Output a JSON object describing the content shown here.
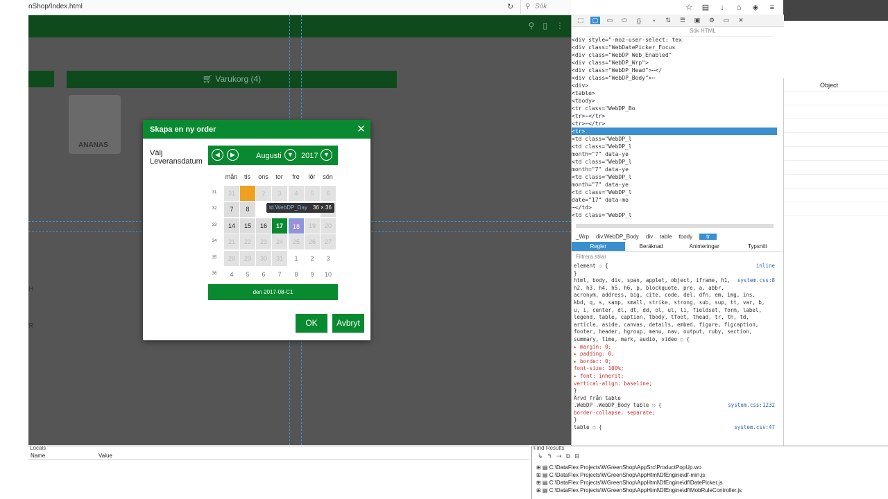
{
  "browser": {
    "url": "nShop/Index.html",
    "reload_icon": "↻",
    "search_placeholder": "Sök"
  },
  "app": {
    "cart_label": "Varukorg (4)",
    "product_name": "ANANAS",
    "side_letters": [
      "H",
      "R"
    ]
  },
  "dialog": {
    "title": "Skapa en ny order",
    "close": "✕",
    "label": "Välj Leveransdatum",
    "month": "Augusti",
    "year": "2017",
    "weekdays": [
      "mån",
      "tis",
      "ons",
      "tor",
      "fre",
      "lör",
      "sön"
    ],
    "weeks": [
      "31",
      "32",
      "33",
      "34",
      "35",
      "36"
    ],
    "rows": [
      [
        {
          "d": "31",
          "s": "out"
        },
        {
          "d": "",
          "s": "today"
        },
        {
          "d": "2",
          "s": "out"
        },
        {
          "d": "3",
          "s": "out"
        },
        {
          "d": "4",
          "s": "out"
        },
        {
          "d": "5",
          "s": "out"
        },
        {
          "d": "6",
          "s": "out"
        }
      ],
      [
        {
          "d": "7",
          "s": "cur"
        },
        {
          "d": "8",
          "s": "cur"
        },
        {
          "d": "",
          "s": "hidden"
        },
        {
          "d": "",
          "s": "hidden"
        },
        {
          "d": "",
          "s": "hidden"
        },
        {
          "d": "",
          "s": "hidden"
        },
        {
          "d": "13",
          "s": "out"
        }
      ],
      [
        {
          "d": "14",
          "s": "cur"
        },
        {
          "d": "15",
          "s": "cur"
        },
        {
          "d": "16",
          "s": "cur"
        },
        {
          "d": "17",
          "s": "sel"
        },
        {
          "d": "18",
          "s": "hov"
        },
        {
          "d": "19",
          "s": "out"
        },
        {
          "d": "20",
          "s": "out"
        }
      ],
      [
        {
          "d": "21",
          "s": "out"
        },
        {
          "d": "22",
          "s": "out"
        },
        {
          "d": "23",
          "s": "out"
        },
        {
          "d": "24",
          "s": "out"
        },
        {
          "d": "25",
          "s": "out"
        },
        {
          "d": "26",
          "s": "out"
        },
        {
          "d": "27",
          "s": "out"
        }
      ],
      [
        {
          "d": "28",
          "s": "out"
        },
        {
          "d": "29",
          "s": "out"
        },
        {
          "d": "30",
          "s": "out"
        },
        {
          "d": "31",
          "s": "out"
        },
        {
          "d": "1",
          "s": "next"
        },
        {
          "d": "2",
          "s": "next"
        },
        {
          "d": "3",
          "s": "next"
        }
      ],
      [
        {
          "d": "4",
          "s": "next"
        },
        {
          "d": "5",
          "s": "next"
        },
        {
          "d": "6",
          "s": "next"
        },
        {
          "d": "7",
          "s": "next"
        },
        {
          "d": "8",
          "s": "next"
        },
        {
          "d": "9",
          "s": "next"
        },
        {
          "d": "10",
          "s": "next"
        }
      ]
    ],
    "tooltip_tag": "td.WebDP_Day",
    "tooltip_size": "36 × 36",
    "footer_date": "den 2017-08-C1",
    "ok": "OK",
    "cancel": "Avbryt"
  },
  "devtools": {
    "search_placeholder": "Sök HTML",
    "tree": [
      {
        "t": "    <div style=\"-moz-user-select: tex",
        "c": ""
      },
      {
        "t": "     <div class=\"WebDatePicker_Focus",
        "c": ""
      },
      {
        "t": "      <div class=\"WebDP Web_Enabled\"",
        "c": ""
      },
      {
        "t": "       <div class=\"WebDP_Wrp\">",
        "c": ""
      },
      {
        "t": "        <div class=\"WebDP_Head\">⋯</",
        "c": ""
      },
      {
        "t": "        <div class=\"WebDP_Body\">⋯",
        "c": ""
      },
      {
        "t": "         <div>",
        "c": ""
      },
      {
        "t": "          <table>",
        "c": ""
      },
      {
        "t": "           <tbody>",
        "c": ""
      },
      {
        "t": "            <tr class=\"WebDP_Bo",
        "c": ""
      },
      {
        "t": "            <tr>⋯</tr>",
        "c": ""
      },
      {
        "t": "            <tr>⋯</tr>",
        "c": ""
      },
      {
        "t": "            <tr>",
        "c": "sel"
      },
      {
        "t": "              <td class=\"WebDP_l",
        "c": ""
      },
      {
        "t": "              <td class=\"WebDP_l",
        "c": ""
      },
      {
        "t": "              month=\"7\" data-ye",
        "c": ""
      },
      {
        "t": "              <td class=\"WebDP_l",
        "c": ""
      },
      {
        "t": "              month=\"7\" data-ye",
        "c": ""
      },
      {
        "t": "              <td class=\"WebDP_l",
        "c": ""
      },
      {
        "t": "              month=\"7\" data-ye",
        "c": ""
      },
      {
        "t": "             <td class=\"WebDP_l",
        "c": ""
      },
      {
        "t": "              date=\"17\" data-mo",
        "c": ""
      },
      {
        "t": "              ⋯</td>",
        "c": ""
      },
      {
        "t": "              <td class=\"WebDP_l",
        "c": ""
      }
    ],
    "crumbs": [
      "_Wrp",
      "div.WebDP_Body",
      "div",
      "table",
      "tbody",
      "tr"
    ],
    "tabs": [
      "Regler",
      "Beräknad",
      "Animeringar",
      "Typsnitt"
    ],
    "filter_placeholder": "Filtrera stilar",
    "rules": [
      "element ◌ {",
      "}",
      "html, body, div, span, applet, object, iframe, h1,",
      "h2, h3, h4, h5, h6, p, blockquote, pre, a, abbr,",
      "acronym, address, big, cite, code, del, dfn, em, img, ins,",
      "kbd, q, s, samp, small, strike, strong, sub, sup, tt, var, b,",
      "u, i, center, dl, dt, dd, ol, ul, li, fieldset, form, label,",
      "legend, table, caption, tbody, tfoot, thead, tr, th, td,",
      "article, aside, canvas, details, embed, figure, figcaption,",
      "footer, header, hgroup, menu, nav, output, ruby, section,",
      "summary, time, mark, audio, video ◌ {",
      "  ▸ margin: 0;",
      "  ▸ padding: 0;",
      "  ▸ border: 0;",
      "    font-size: 100%;",
      "  ▸ font: inherit;",
      "    vertical-align: baseline;",
      "}",
      "Ärvd från table",
      ".WebDP .WebDP_Body table ◌ {",
      "    border-collapse: separate;",
      "}",
      "table ◌ {"
    ],
    "rule_sources": [
      "inline",
      "system.css:8",
      "system.css:1232",
      "system.css:47"
    ]
  },
  "right_panel": {
    "header": "Object"
  },
  "locals": {
    "title": "Locals",
    "col_name": "Name",
    "col_value": "Value"
  },
  "find": {
    "title": "Find Results",
    "lines": [
      "C:\\DataFlex Projects\\WGreenShop\\AppSrc\\ProductPopUp.wo",
      "C:\\DataFlex Projects\\WGreenShop\\AppHtml\\DfEngine\\df-min.js",
      "C:\\DataFlex Projects\\WGreenShop\\AppHtml\\DfEngine\\df\\DatePicker.js",
      "C:\\DataFlex Projects\\WGreenShop\\AppHtml\\DfEngine\\df\\MobRuleController.js"
    ]
  },
  "colors": {
    "accent": "#0a8a30",
    "dark_green": "#0f4a1d",
    "highlight": "#3a8fd0",
    "today": "#f0a020"
  }
}
